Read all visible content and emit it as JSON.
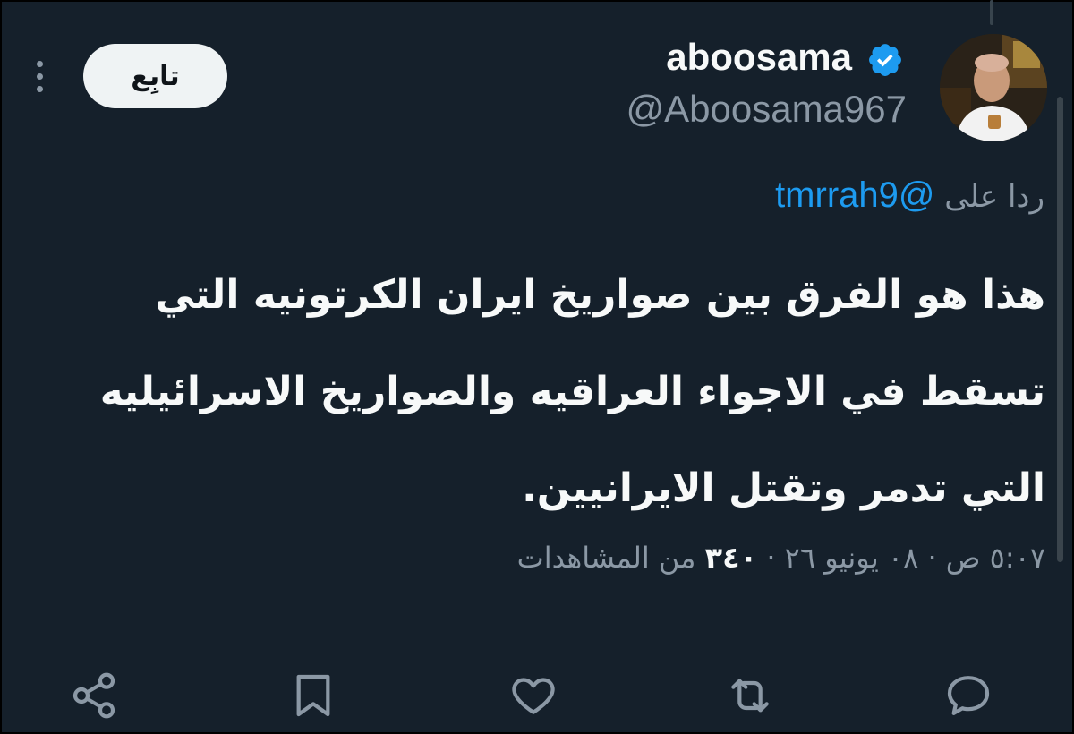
{
  "author": {
    "display_name": "aboosama",
    "handle": "@Aboosama967",
    "verified": true,
    "avatar_icon": "user-photo"
  },
  "follow_button": {
    "label": "تابِع"
  },
  "more_icon": "more-vertical-icon",
  "reply": {
    "prefix": "ردا على",
    "mention": "@tmrrah9"
  },
  "tweet": {
    "text": "هذا هو الفرق بين صواريخ ايران الكرتونيه التي تسقط في الاجواء العراقيه والصواريخ الاسرائيليه التي تدمر وتقتل الايرانيين."
  },
  "meta": {
    "time": "٥:٠٧ ص",
    "separator": "·",
    "date": "٠٨ يونيو ٢٦",
    "views_count": "٣٤٠",
    "views_label": "من المشاهدات"
  },
  "actions": [
    {
      "name": "share",
      "icon": "share-icon"
    },
    {
      "name": "bookmark",
      "icon": "bookmark-icon"
    },
    {
      "name": "like",
      "icon": "heart-icon"
    },
    {
      "name": "retweet",
      "icon": "retweet-icon"
    },
    {
      "name": "reply",
      "icon": "reply-icon"
    }
  ],
  "colors": {
    "background": "#15202b",
    "text": "#f7f9f9",
    "secondary": "#8b98a5",
    "accent": "#1d9bf0"
  }
}
